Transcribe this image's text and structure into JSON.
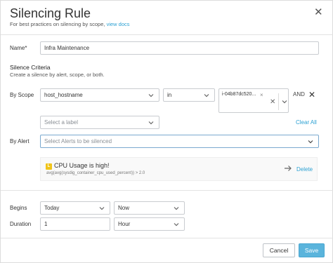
{
  "dialog": {
    "title": "Silencing Rule",
    "subtitle_text": "For best practices on silencing by scope,",
    "subtitle_link": "view docs"
  },
  "name_field": {
    "label": "Name*",
    "value": "Infra Maintenance"
  },
  "criteria": {
    "title": "Silence Criteria",
    "subtitle": "Create a silence by alert, scope, or both."
  },
  "scope": {
    "label": "By Scope",
    "key_value": "host_hostname",
    "operator_value": "in",
    "tag_value": "i-04b87dc520...",
    "and_label": "AND",
    "label_placeholder": "Select a label",
    "clear_all": "Clear All"
  },
  "alert": {
    "label": "By Alert",
    "placeholder": "Select Alerts to be silenced",
    "selected": {
      "badge": "L",
      "name": "CPU Usage is high!",
      "expression": "avg(avg(sysdig_container_cpu_used_percent)) > 2.0",
      "delete_label": "Delete"
    }
  },
  "schedule": {
    "begins_label": "Begins",
    "begins_date": "Today",
    "begins_time": "Now",
    "duration_label": "Duration",
    "duration_value": "1",
    "duration_unit": "Hour"
  },
  "footer": {
    "cancel_label": "Cancel",
    "save_label": "Save"
  },
  "colors": {
    "accent": "#2ca1d3",
    "save_button": "#5ab4dc",
    "alert_badge": "#f0c419"
  }
}
